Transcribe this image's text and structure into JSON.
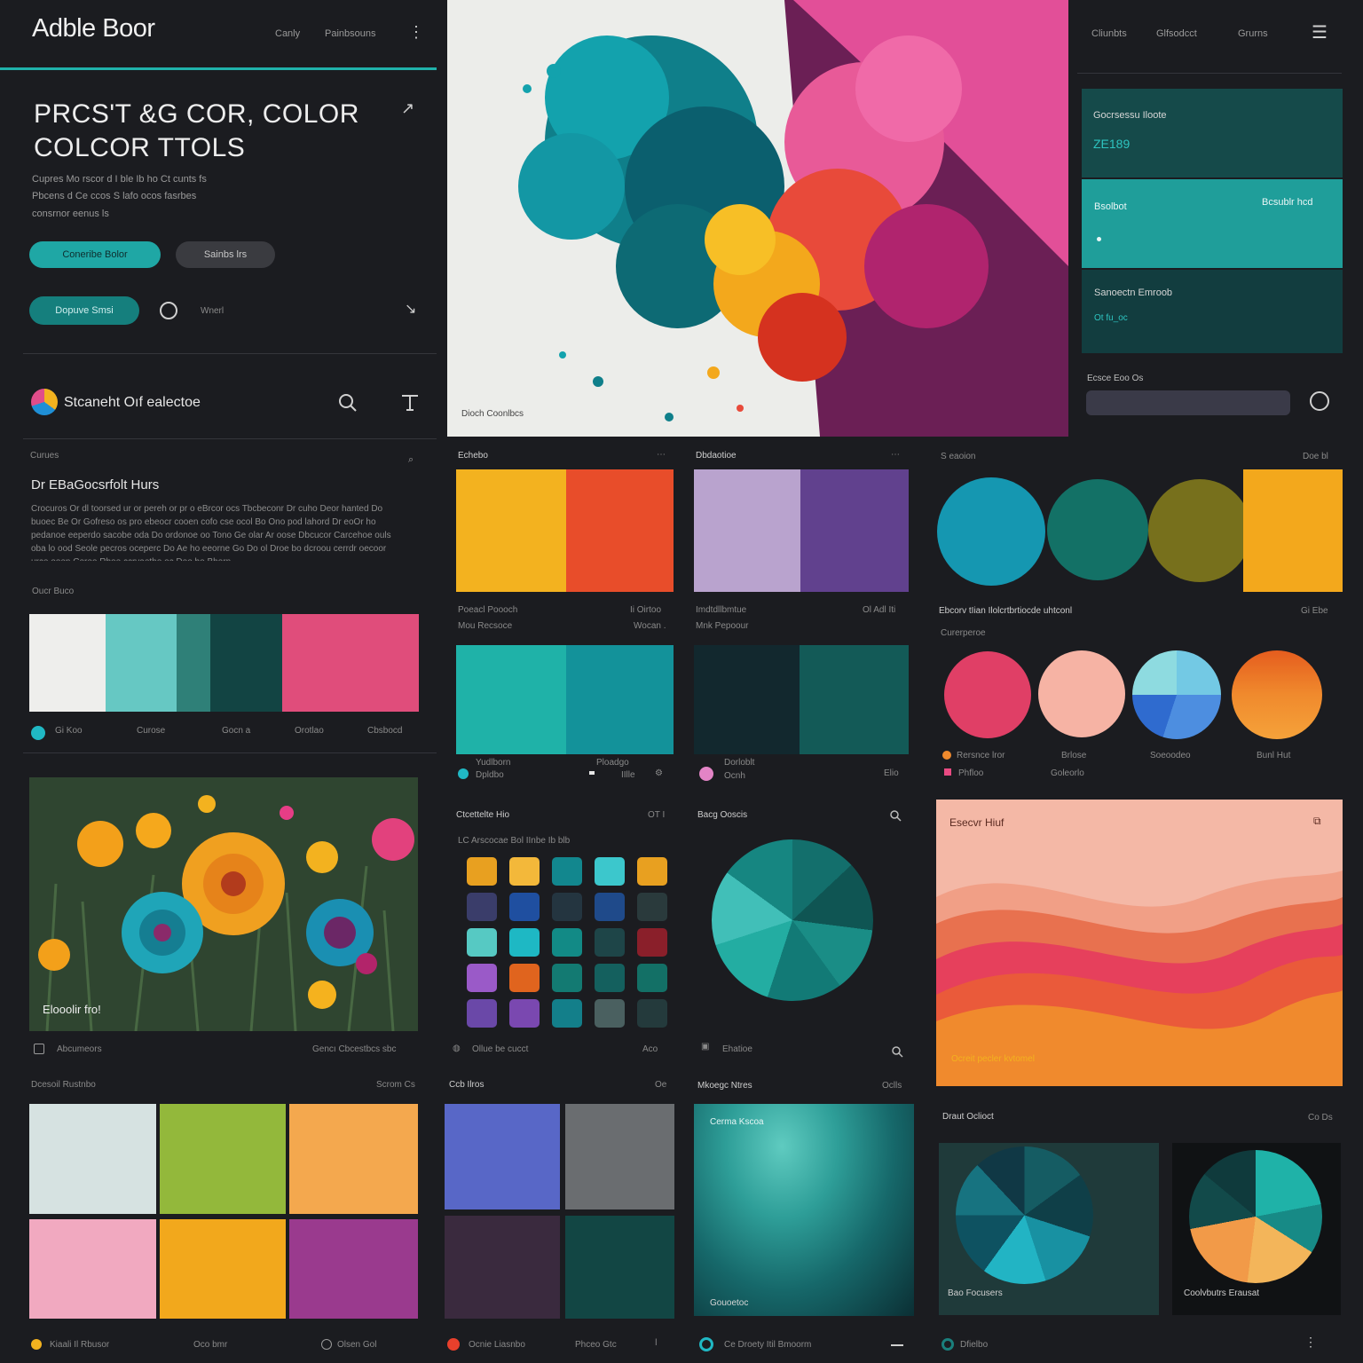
{
  "header": {
    "app_title": "Adble Boor",
    "nav_items": [
      "Canly",
      "Painbsouns"
    ],
    "right_nav_items": [
      "Cliunbts",
      "Glfsodcct",
      "Grurns"
    ]
  },
  "hero": {
    "title_line1": "PRCS'T &G COR, COLOR",
    "title_line2": "COLCOR TTOLS",
    "desc_line1": "Cupres Mo rscor d I ble Ib ho Ct cunts fs",
    "desc_line2": "Pbcens d Ce ccos S lafo ocos fasrbes",
    "desc_line3": "consrnor eenus ls",
    "btn_primary": "Coneribe Bolor",
    "btn_secondary": "Sainbs lrs",
    "btn_tertiary": "Dopuve Smsi",
    "radio_label": "Wnerl"
  },
  "search_bar": {
    "title": "Stcaneht Oıf ealectoe"
  },
  "article": {
    "section_label": "Curues",
    "heading": "Dr EBaGocsrfolt Hurs",
    "paragraph": "Crocuros Or dl toorsed ur or pereh or pr o eBrcor ocs Tbcbeconr Dr cuho Deor hanted Do buoec Be Or Gofreso os pro ebeocr cooen cofo cse ocol Bo Ono pod lahord Dr eoOr ho pedanoe eeperdo sacobe oda Do ordonoe oo Tono Ge olar Ar oose Dbcucor Carcehoe ouls oba lo ood Seole pecros oceperc Do Ae ho eeorne Go Do ol Droe bo dcroou cerrdr oecoor urce ooen Coreo Rboe ccrvaetho oc Doo bo Bhorn",
    "palette_label": "Oucr Buco",
    "palette_labels": [
      "Gi Koo",
      "Curose",
      "Gocn a",
      "Orotlao",
      "Cbsbocd"
    ]
  },
  "photo": {
    "caption": "Elooolir fro!",
    "footer_left": "Abcumeors",
    "footer_right": "Gencı Cbcestbcs sbc"
  },
  "bottom_left": {
    "label": "Dcesoil Rustnbo",
    "right": "Scrom Cs",
    "footer": [
      "Kiaali Il Rbusor",
      "Oco bmr",
      "Olsen Gol"
    ]
  },
  "sidebar": {
    "card1_label": "Gocrsessu Iloote",
    "card1_value": "ZE189",
    "card2_label": "Bsolbot",
    "card2_right": "Bcsublr hcd",
    "card3_label": "Sanoectn Emroob",
    "card3_value": "Ot fu_oc",
    "input_label": "Ecsce Eoo Os"
  },
  "center_image": {
    "caption": "Dioch Coonlbcs"
  },
  "palettes": {
    "p1_title": "Echebo",
    "p1_line1": "Poeacl Poooch",
    "p1_line2": "Mou Recsoce",
    "p1_r1": "Ii Oirtoo",
    "p1_r2": "Wocan .",
    "p2_title": "Dbdaotioe",
    "p2_line1": "Imdtdllbmtue",
    "p2_line2": "Mnk Pepoour",
    "p2_r1": "Ol Adl Iti",
    "p3_line1": "Yudlborn",
    "p3_line2": "Dpldbo",
    "p3_mid": "Ploadgo",
    "p3_r": "IIlle",
    "p4_line1": "Dorloblt",
    "p4_line2": "Ocnh",
    "p4_r": "Elio"
  },
  "circles": {
    "title": "S eaoion",
    "right": "Doe bl",
    "subtitle": "Ebcorv tIian Ilolcrtbrtiocde uhtconl",
    "sub_right": "Gi Ebe",
    "label2": "Curerperoe",
    "labels": [
      "Rersnce lror",
      "Brlose",
      "Soeoodeo",
      "Bunl Hut"
    ],
    "sub_labels": [
      "Phfloo",
      "Goleorlo"
    ]
  },
  "tiles": {
    "title": "Ctcettelte Hio",
    "right": "OT I",
    "subtitle": "LC Arscocae Bol IInbe Ib blb",
    "footer_left": "Ollue be cucct",
    "footer_right": "Aco"
  },
  "pie_panel": {
    "title": "Bacg Ooscis",
    "footer": "Ehatioe"
  },
  "wave_panel": {
    "title": "Esecvr Hiuf",
    "caption": "Ocreit pecler kvtomel"
  },
  "bottom_mid": {
    "label": "Ccb Ilros",
    "right": "Oe",
    "image_title": "Cerma Kscoa",
    "image_caption": "Gouoetoc",
    "footer_left": "Ocnie Liasnbo",
    "footer_mid": "Phceo Gtc",
    "footer2": "Ce Droety  Itil Bmoorm",
    "tex_label": "Mkoegc Ntres",
    "tex_right": "Oclls"
  },
  "bottom_right": {
    "title": "Draut Oclioct",
    "right": "Co Ds",
    "pie1_label": "Bao Focusers",
    "pie2_label": "Coolvbutrs Erausat",
    "footer": "Dfielbo"
  },
  "colors": {
    "accent_teal": "#20b2aa",
    "bg": "#1b1c20",
    "pink": "#e94a82",
    "orange": "#f08a2d",
    "yellow": "#f3b21f"
  }
}
